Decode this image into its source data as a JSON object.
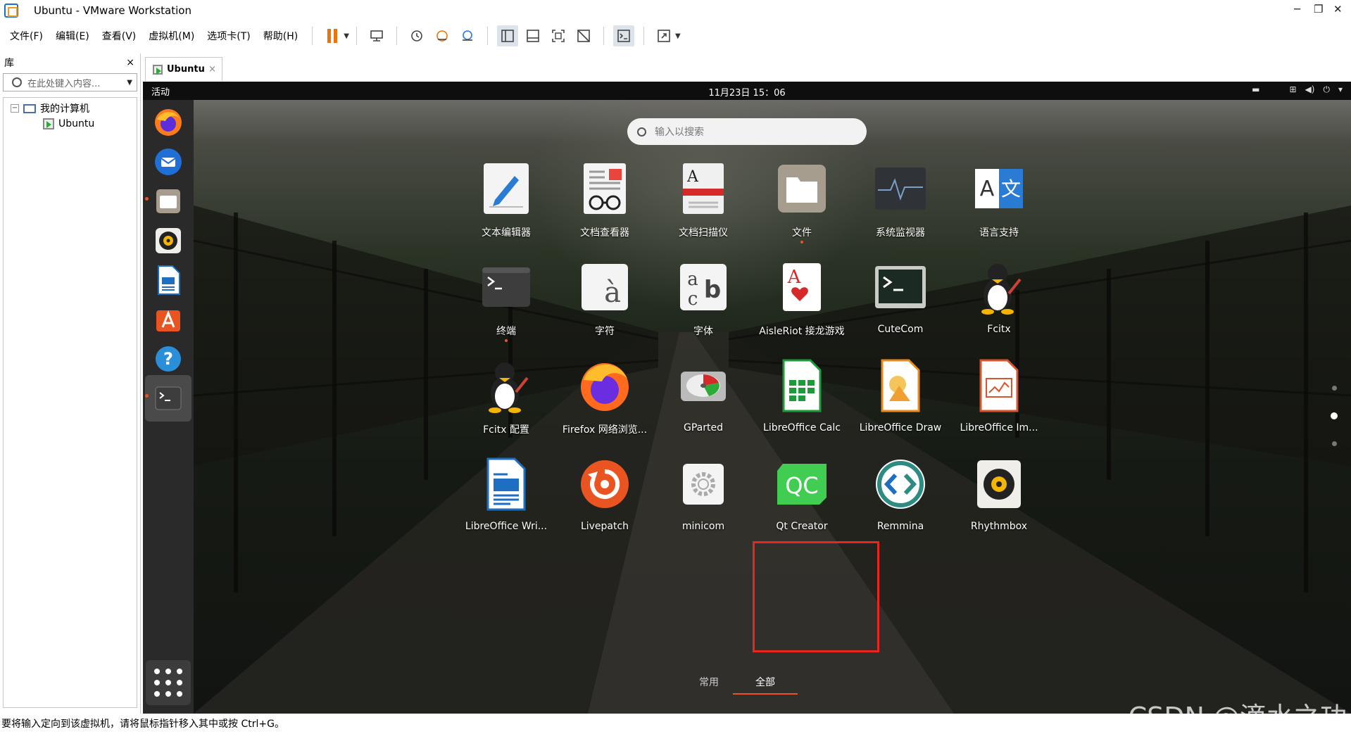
{
  "window": {
    "title": "Ubuntu - VMware Workstation",
    "minimize": "─",
    "restore": "❐",
    "close": "✕"
  },
  "menu": {
    "items": [
      "文件(F)",
      "编辑(E)",
      "查看(V)",
      "虚拟机(M)",
      "选项卡(T)",
      "帮助(H)"
    ]
  },
  "library": {
    "title": "库",
    "close": "×",
    "search_placeholder": "在此处键入内容...",
    "tree": {
      "root": "我的计算机",
      "toggle": "−",
      "child": "Ubuntu"
    }
  },
  "vm_tab": {
    "label": "Ubuntu",
    "close": "×"
  },
  "ubuntu": {
    "activities": "活动",
    "clock": "11月23日  15：06",
    "search_placeholder": "输入以搜索",
    "apps": [
      {
        "label": "文本编辑器",
        "icon": "text-editor-icon"
      },
      {
        "label": "文档查看器",
        "icon": "document-viewer-icon"
      },
      {
        "label": "文档扫描仪",
        "icon": "document-scanner-icon"
      },
      {
        "label": "文件",
        "icon": "files-icon"
      },
      {
        "label": "系统监视器",
        "icon": "system-monitor-icon"
      },
      {
        "label": "语言支持",
        "icon": "language-support-icon"
      },
      {
        "label": "终端",
        "icon": "terminal-icon"
      },
      {
        "label": "字符",
        "icon": "characters-icon"
      },
      {
        "label": "字体",
        "icon": "fonts-icon"
      },
      {
        "label": "AisleRiot 接龙游戏",
        "icon": "aisleriot-icon"
      },
      {
        "label": "CuteCom",
        "icon": "cutecom-icon"
      },
      {
        "label": "Fcitx",
        "icon": "fcitx-icon"
      },
      {
        "label": "Fcitx 配置",
        "icon": "fcitx-config-icon"
      },
      {
        "label": "Firefox 网络浏览...",
        "icon": "firefox-icon"
      },
      {
        "label": "GParted",
        "icon": "gparted-icon"
      },
      {
        "label": "LibreOffice Calc",
        "icon": "libreoffice-calc-icon"
      },
      {
        "label": "LibreOffice Draw",
        "icon": "libreoffice-draw-icon"
      },
      {
        "label": "LibreOffice Im...",
        "icon": "libreoffice-impress-icon"
      },
      {
        "label": "LibreOffice Wri...",
        "icon": "libreoffice-writer-icon"
      },
      {
        "label": "Livepatch",
        "icon": "livepatch-icon"
      },
      {
        "label": "minicom",
        "icon": "minicom-icon"
      },
      {
        "label": "Qt Creator",
        "icon": "qt-creator-icon"
      },
      {
        "label": "Remmina",
        "icon": "remmina-icon"
      },
      {
        "label": "Rhythmbox",
        "icon": "rhythmbox-icon"
      }
    ],
    "bottom_tabs": {
      "frequent": "常用",
      "all": "全部"
    },
    "dock": [
      "firefox-icon",
      "thunderbird-icon",
      "files-icon",
      "rhythmbox-icon",
      "libreoffice-writer-icon",
      "software-icon",
      "help-icon",
      "terminal-icon"
    ]
  },
  "watermark": "CSDN @滴水之功",
  "status": "要将输入定向到该虚拟机，请将鼠标指针移入其中或按 Ctrl+G。",
  "colors": {
    "ubuntu_orange": "#e95420",
    "highlight": "#e8261e",
    "pause": "#e8730f"
  }
}
